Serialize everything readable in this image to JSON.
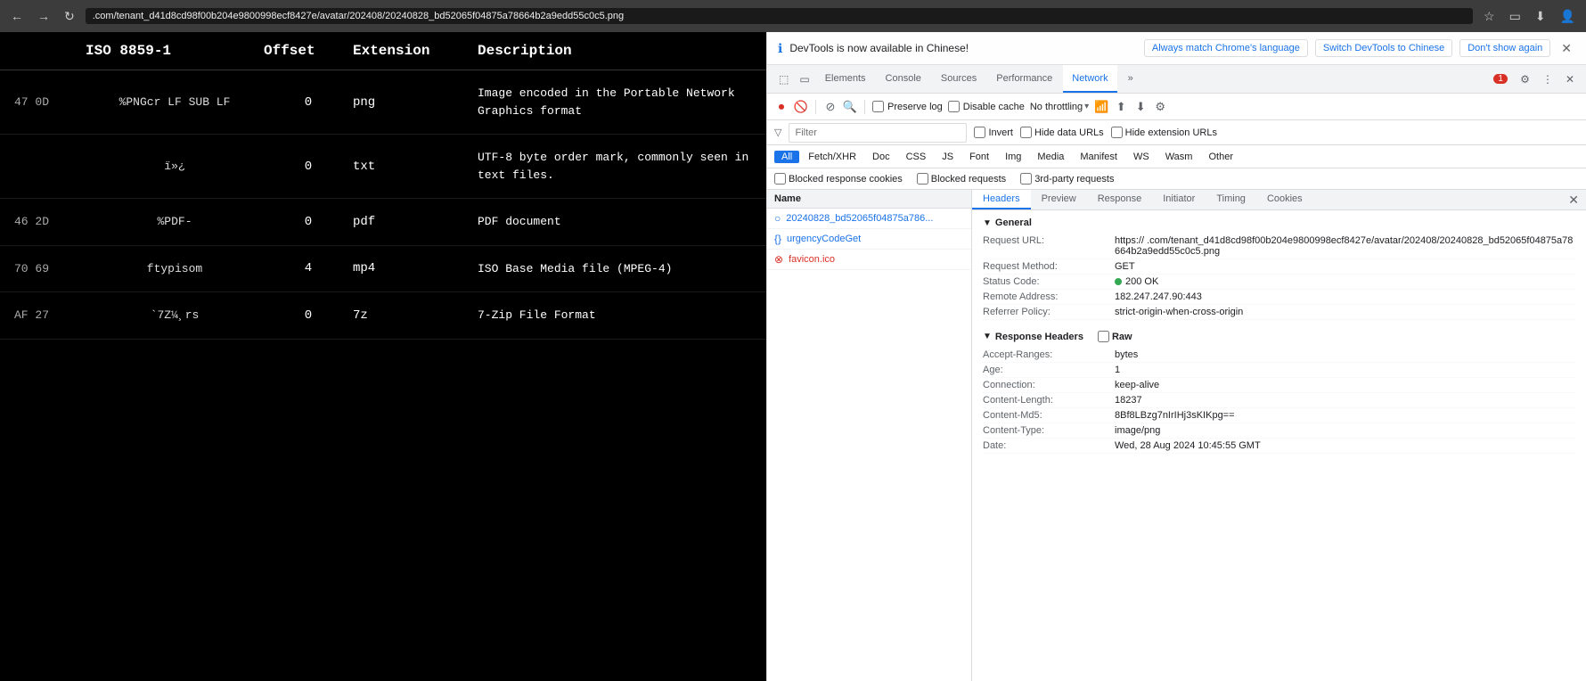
{
  "browser": {
    "url": ".com/tenant_d41d8cd98f00b204e9800998ecf8427e/avatar/202408/20240828_bd52065f04875a78664b2a9edd55c0c5.png",
    "favicon": "⭐",
    "download_icon": "⬇",
    "profile_icon": "👤"
  },
  "file_table": {
    "headers": [
      "",
      "ISO 8859-1",
      "Offset",
      "Extension",
      "Description"
    ],
    "rows": [
      {
        "hex": "47 0D",
        "sig": "%PNGcr LF SUB LF",
        "offset": "0",
        "ext": "png",
        "desc": "Image encoded in the Portable Network Graphics format"
      },
      {
        "hex": "",
        "sig": "ï»¿",
        "offset": "0",
        "ext": "txt",
        "desc": "UTF-8 byte order mark, commonly seen in text files."
      },
      {
        "hex": "46 2D",
        "sig": "%PDF-",
        "offset": "0",
        "ext": "pdf",
        "desc": "PDF document"
      },
      {
        "hex": "70 69",
        "sig": "ftypisom",
        "offset": "4",
        "ext": "mp4",
        "desc": "ISO Base Media file (MPEG-4)"
      },
      {
        "hex": "AF 27",
        "sig": "`7Z¼¸rs",
        "offset": "0",
        "ext": "7z",
        "desc": "7-Zip File Format"
      }
    ]
  },
  "devtools": {
    "notification": {
      "text": "DevTools is now available in Chinese!",
      "btn1": "Always match Chrome's language",
      "btn2": "Switch DevTools to Chinese",
      "btn3": "Don't show again"
    },
    "tabs": [
      "Elements",
      "Console",
      "Sources",
      "Performance",
      "Network",
      "»"
    ],
    "active_tab": "Network",
    "tab_icons": {
      "settings": "⚙",
      "more": "⋮",
      "close": "✕",
      "error_count": "1",
      "device_toggle": "📱",
      "inspect": "⬚"
    },
    "toolbar": {
      "record_stop": "⏺",
      "clear": "🚫",
      "filter_icon": "⊘",
      "search_icon": "🔍",
      "preserve_log_label": "Preserve log",
      "disable_cache_label": "Disable cache",
      "throttling_label": "No throttling",
      "upload_icon": "⬆",
      "download_icon": "⬇",
      "settings_icon": "⚙"
    },
    "filter_bar": {
      "placeholder": "Filter",
      "invert_label": "Invert",
      "hide_data_urls_label": "Hide data URLs",
      "hide_extension_urls_label": "Hide extension URLs"
    },
    "type_pills": [
      "All",
      "Fetch/XHR",
      "Doc",
      "CSS",
      "JS",
      "Font",
      "Img",
      "Media",
      "Manifest",
      "WS",
      "Wasm",
      "Other"
    ],
    "active_type_pill": "All",
    "blocked_bar": {
      "blocked_cookies_label": "Blocked response cookies",
      "blocked_requests_label": "Blocked requests",
      "third_party_label": "3rd-party requests"
    },
    "request_list": {
      "header": "Name",
      "items": [
        {
          "name": "20240828_bd52065f04875a786...",
          "type": "doc",
          "error": false
        },
        {
          "name": "urgencyCodeGet",
          "type": "doc",
          "error": false
        },
        {
          "name": "favicon.ico",
          "type": "error",
          "error": true
        }
      ]
    },
    "detail_tabs": [
      "Headers",
      "Preview",
      "Response",
      "Initiator",
      "Timing",
      "Cookies"
    ],
    "active_detail_tab": "Headers",
    "detail_close": "✕",
    "general": {
      "title": "General",
      "request_url_key": "Request URL:",
      "request_url_val": "https://          .com/tenant_d41d8cd98f00b204e9800998ecf8427e/avatar/202408/20240828_bd52065f04875a78664b2a9edd55c0c5.png",
      "method_key": "Request Method:",
      "method_val": "GET",
      "status_key": "Status Code:",
      "status_val": "200 OK",
      "remote_key": "Remote Address:",
      "remote_val": "182.247.247.90:443",
      "referrer_key": "Referrer Policy:",
      "referrer_val": "strict-origin-when-cross-origin"
    },
    "response_headers": {
      "title": "Response Headers",
      "raw_label": "Raw",
      "rows": [
        {
          "key": "Accept-Ranges:",
          "val": "bytes"
        },
        {
          "key": "Age:",
          "val": "1"
        },
        {
          "key": "Connection:",
          "val": "keep-alive"
        },
        {
          "key": "Content-Length:",
          "val": "18237"
        },
        {
          "key": "Content-Md5:",
          "val": "8Bf8LBzg7nIrIHj3sKIKpg=="
        },
        {
          "key": "Content-Type:",
          "val": "image/png"
        },
        {
          "key": "Date:",
          "val": "Wed, 28 Aug 2024 10:45:55 GMT"
        }
      ]
    }
  }
}
